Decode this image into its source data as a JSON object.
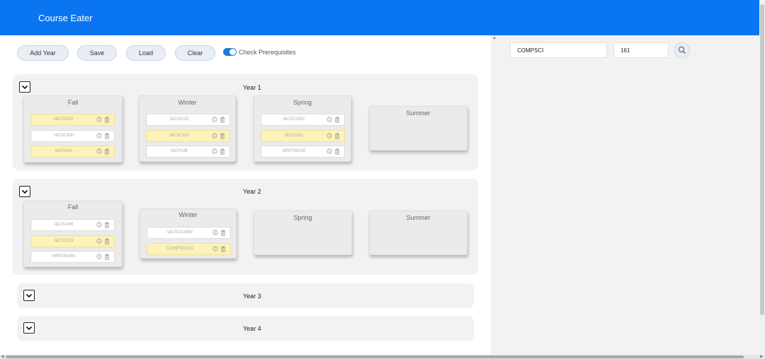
{
  "app": {
    "title": "Course Eater"
  },
  "toolbar": {
    "add_year": "Add Year",
    "save": "Save",
    "load": "Load",
    "clear": "Clear",
    "check_prereq": "Check Prerequisites",
    "check_prereq_on": true
  },
  "years": [
    {
      "title": "Year 1",
      "expanded": true,
      "quarters": [
        {
          "name": "Fall",
          "courses": [
            {
              "code": "I&CSCI32",
              "highlight": true
            },
            {
              "code": "I&CSCI6D",
              "highlight": false
            },
            {
              "code": "MATH2A",
              "highlight": true
            }
          ]
        },
        {
          "name": "Winter",
          "courses": [
            {
              "code": "I&CSCI33",
              "highlight": false
            },
            {
              "code": "I&CSCI6D",
              "highlight": true
            },
            {
              "code": "MATH2B",
              "highlight": false
            }
          ]
        },
        {
          "name": "Spring",
          "courses": [
            {
              "code": "I&CSCI45C",
              "highlight": false
            },
            {
              "code": "I&CSCI51",
              "highlight": true
            },
            {
              "code": "WRITING30",
              "highlight": false
            }
          ]
        },
        {
          "name": "Summer",
          "courses": []
        }
      ]
    },
    {
      "title": "Year 2",
      "expanded": true,
      "quarters": [
        {
          "name": "Fall",
          "courses": [
            {
              "code": "I&CSCI46",
              "highlight": false
            },
            {
              "code": "I&CSCI53",
              "highlight": true
            },
            {
              "code": "WRITING60",
              "highlight": false
            }
          ]
        },
        {
          "name": "Winter",
          "courses": [
            {
              "code": "I&CSCI139W",
              "highlight": false
            },
            {
              "code": "COMPSCI161",
              "highlight": true
            }
          ]
        },
        {
          "name": "Spring",
          "courses": []
        },
        {
          "name": "Summer",
          "courses": []
        }
      ]
    },
    {
      "title": "Year 3",
      "expanded": false,
      "quarters": []
    },
    {
      "title": "Year 4",
      "expanded": false,
      "quarters": []
    }
  ],
  "search": {
    "department": "COMPSCI",
    "number": "161"
  },
  "colors": {
    "header": "#0a75f0",
    "highlight": "#fdf3b8",
    "toggle": "#1f7ae0"
  },
  "icons": {
    "expand": "chevron-down-icon",
    "info": "info-icon",
    "delete": "trash-icon",
    "search": "search-icon"
  }
}
